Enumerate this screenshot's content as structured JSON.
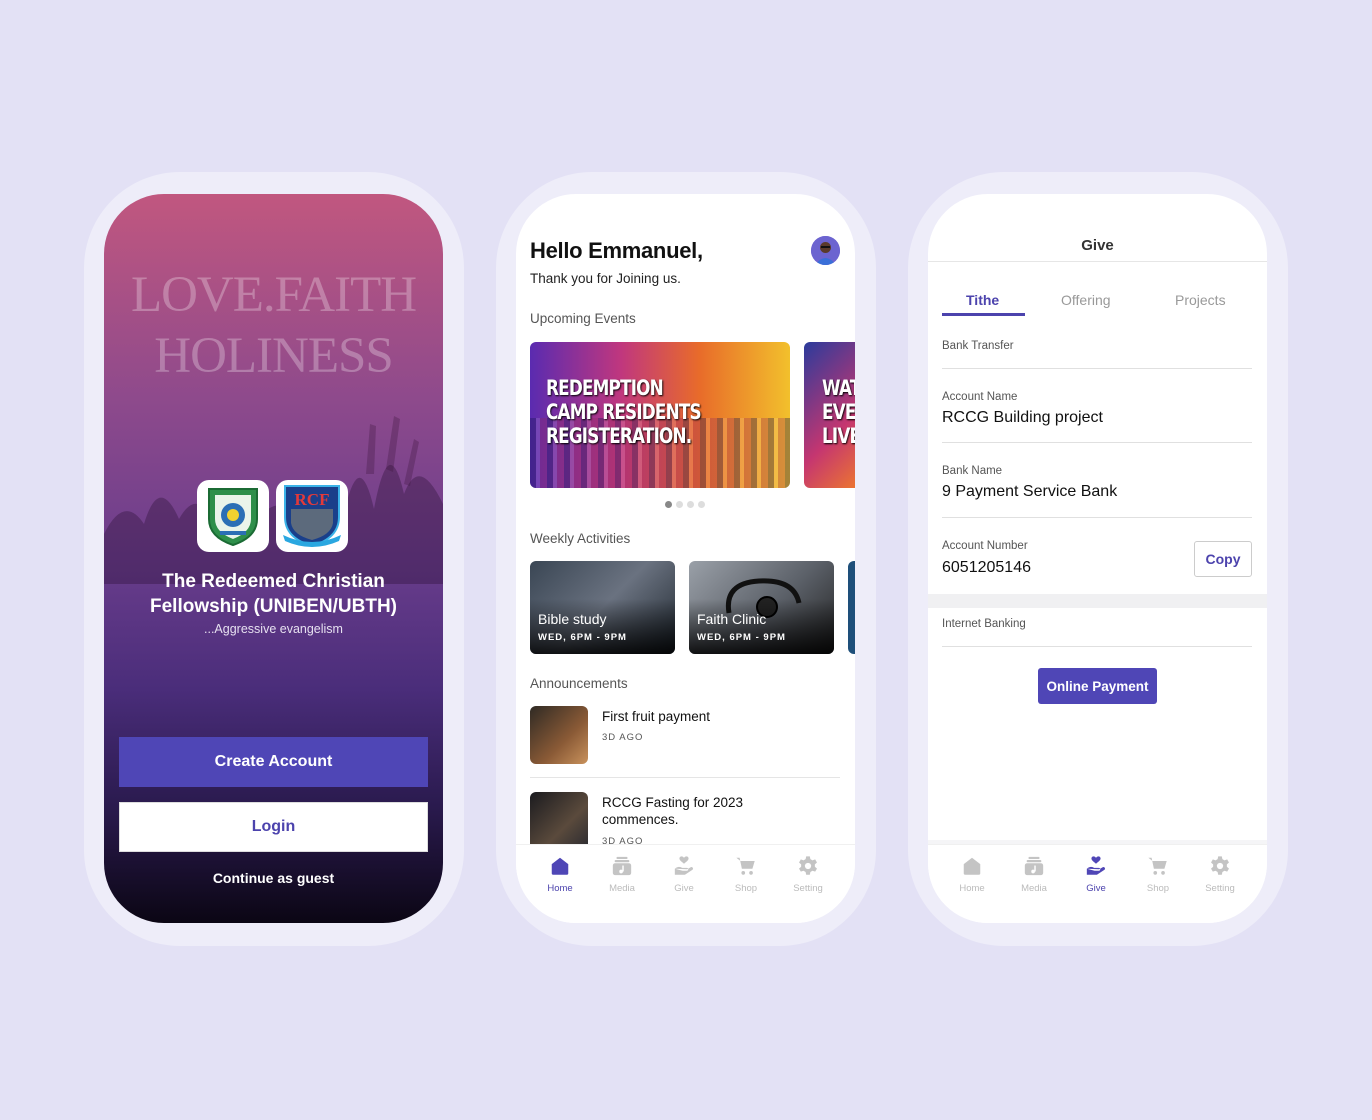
{
  "colors": {
    "background": "#e3e1f5",
    "accent": "#4f46b6",
    "inactive_tab": "#bbbbbb"
  },
  "welcome": {
    "motto_line1": "LOVE.FAITH",
    "motto_line2": "HOLINESS",
    "title_line1": "The Redeemed Christian",
    "title_line2": "Fellowship (UNIBEN/UBTH)",
    "tagline": "...Aggressive evangelism",
    "logo2_text": "RCF",
    "create_account_label": "Create Account",
    "login_label": "Login",
    "guest_label": "Continue as guest"
  },
  "home": {
    "greeting": "Hello Emmanuel,",
    "subtitle": "Thank you for Joining us.",
    "upcoming_label": "Upcoming Events",
    "events": [
      {
        "title": "REDEMPTION\nCAMP RESIDENTS\nREGISTERATION."
      },
      {
        "title": "WAT\nEVE\nLIVE"
      }
    ],
    "carousel": {
      "pages": 4,
      "active": 1
    },
    "weekly_label": "Weekly Activities",
    "activities": [
      {
        "title": "Bible study",
        "time": "WED, 6PM - 9PM"
      },
      {
        "title": "Faith Clinic",
        "time": "WED, 6PM - 9PM"
      }
    ],
    "announcements_label": "Announcements",
    "announcements": [
      {
        "title": "First fruit payment",
        "time": "3D AGO"
      },
      {
        "title": "RCCG Fasting for 2023 commences.",
        "time": "3D AGO"
      }
    ]
  },
  "give": {
    "title": "Give",
    "tabs": [
      "Tithe",
      "Offering",
      "Projects"
    ],
    "active_tab": "Tithe",
    "bank_transfer_label": "Bank Transfer",
    "account_name_label": "Account Name",
    "account_name": "RCCG Building project",
    "bank_name_label": "Bank Name",
    "bank_name": "9 Payment Service Bank",
    "account_number_label": "Account Number",
    "account_number": "6051205146",
    "copy_label": "Copy",
    "internet_banking_label": "Internet Banking",
    "online_payment_label": "Online Payment"
  },
  "tabbar": {
    "items": [
      {
        "label": "Home",
        "icon": "home-icon"
      },
      {
        "label": "Media",
        "icon": "media-icon"
      },
      {
        "label": "Give",
        "icon": "give-icon"
      },
      {
        "label": "Shop",
        "icon": "cart-icon"
      },
      {
        "label": "Setting",
        "icon": "gear-icon"
      }
    ],
    "home_active": "Home",
    "give_active": "Give"
  }
}
